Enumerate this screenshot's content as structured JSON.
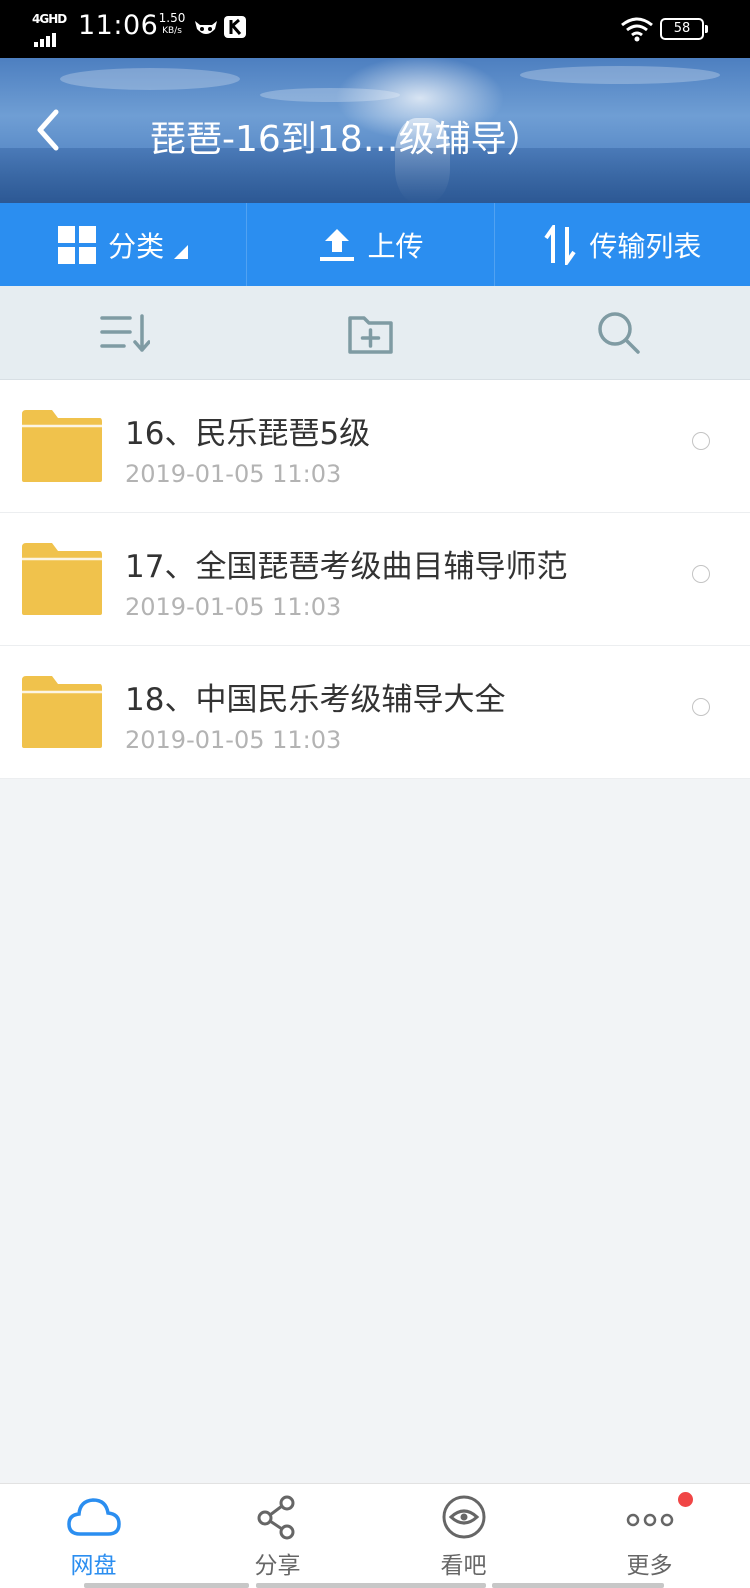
{
  "status_bar": {
    "network": "4GHD",
    "time": "11:06",
    "speed_value": "1.50",
    "speed_unit": "KB/s",
    "battery": "58"
  },
  "header": {
    "title": "琵琶-16到18…级辅导）"
  },
  "toolbar": {
    "category_label": "分类",
    "upload_label": "上传",
    "transfer_label": "传输列表"
  },
  "files": [
    {
      "name": "16、民乐琵琶5级",
      "date": "2019-01-05  11:03"
    },
    {
      "name": "17、全国琵琶考级曲目辅导师范",
      "date": "2019-01-05  11:03"
    },
    {
      "name": "18、中国民乐考级辅导大全",
      "date": "2019-01-05  11:03"
    }
  ],
  "bottom_nav": {
    "items": [
      {
        "label": "网盘",
        "icon": "cloud-icon",
        "active": true
      },
      {
        "label": "分享",
        "icon": "share-icon",
        "active": false
      },
      {
        "label": "看吧",
        "icon": "eye-icon",
        "active": false
      },
      {
        "label": "更多",
        "icon": "more-icon",
        "active": false
      }
    ]
  },
  "colors": {
    "accent": "#2b8ef0",
    "folder": "#f0c24c",
    "badge": "#f04646"
  }
}
